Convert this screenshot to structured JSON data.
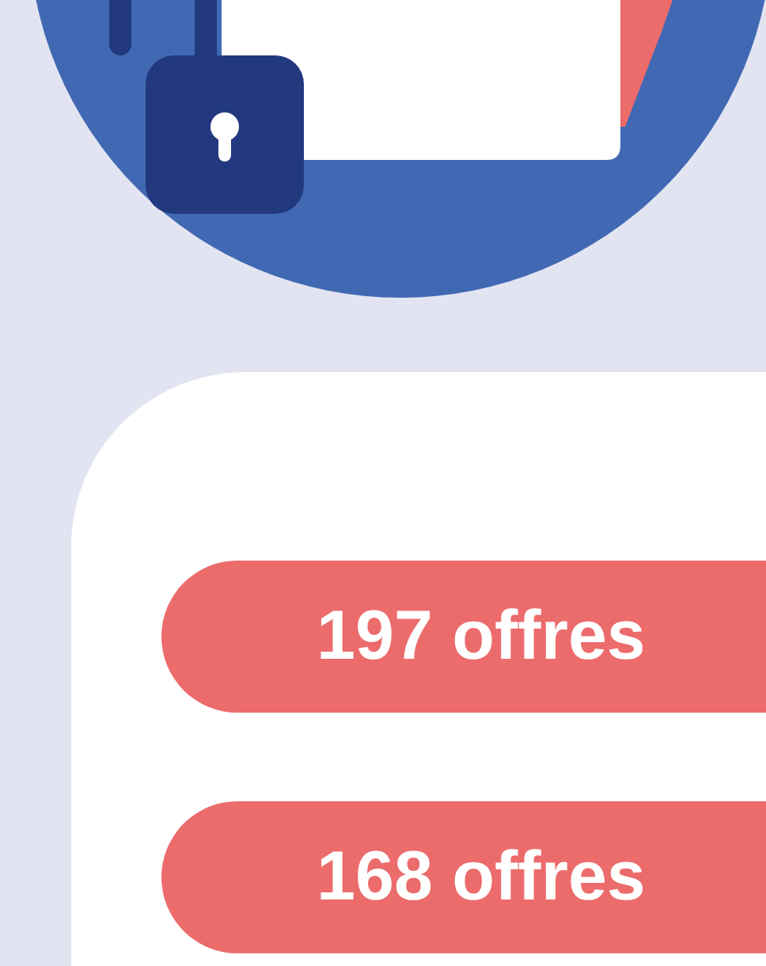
{
  "offers": [
    {
      "label": "197 offres"
    },
    {
      "label": "168 offres"
    }
  ]
}
